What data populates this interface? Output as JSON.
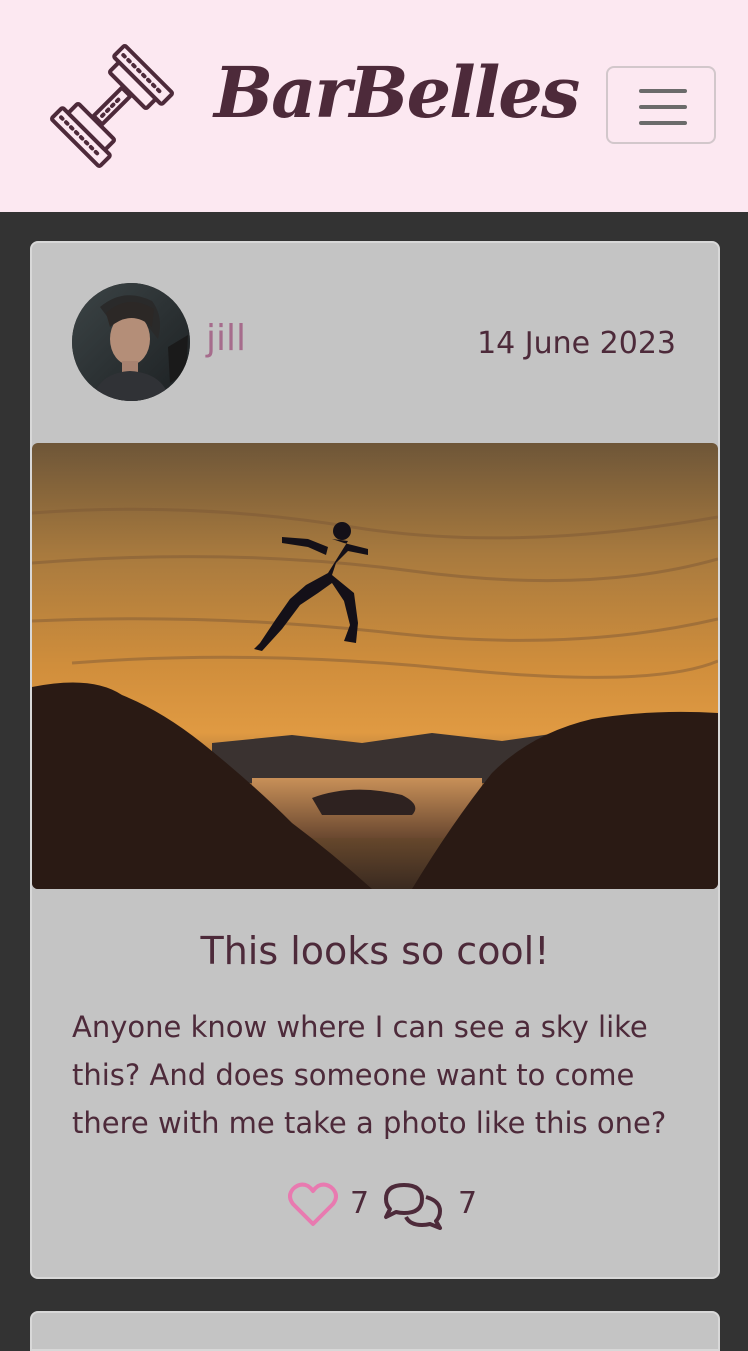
{
  "navbar": {
    "brand": "BarBelles",
    "logo_icon": "barbell-icon",
    "menu_icon": "hamburger-menu-icon"
  },
  "post": {
    "author": "jill",
    "date": "14 June 2023",
    "title": "This looks so cool!",
    "body": "Anyone know where I can see a sky like this? And does someone want to come there with me take a photo like this one?",
    "likes": "7",
    "comments": "7",
    "like_icon": "heart-icon",
    "comment_icon": "comments-icon"
  },
  "colors": {
    "navbar_bg": "#fce8f1",
    "page_bg": "#333333",
    "card_bg": "#c4c4c4",
    "text": "#4d2a3a",
    "author": "#a66c8c",
    "heart": "#e87ab0"
  }
}
